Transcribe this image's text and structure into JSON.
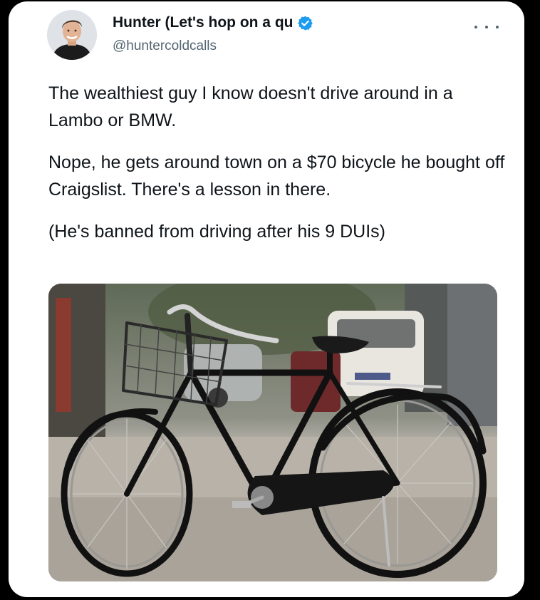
{
  "tweet": {
    "author": {
      "display_name": "Hunter (Let's hop on a qu",
      "handle": "@huntercoldcalls",
      "verified": true,
      "avatar_icon": "profile-photo"
    },
    "text": [
      "The wealthiest guy I know doesn't drive around in a Lambo or BMW.",
      "Nope, he gets around town on a $70 bicycle he bought off Craigslist. There's a lesson in there.",
      "(He's banned from driving after his 9 DUIs)"
    ],
    "more_icon": "more-options-icon",
    "media": {
      "type": "photo",
      "subject": "black-bicycle-with-front-basket"
    }
  },
  "colors": {
    "background": "#000000",
    "card": "#ffffff",
    "text_primary": "#0f1419",
    "text_secondary": "#536471",
    "verified_blue": "#1d9bf0"
  }
}
